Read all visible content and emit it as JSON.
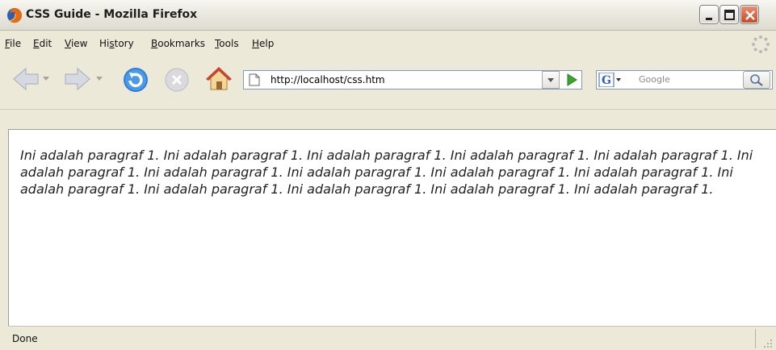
{
  "window": {
    "title": "CSS Guide - Mozilla Firefox"
  },
  "menu": {
    "items": [
      {
        "key": "F",
        "rest": "ile"
      },
      {
        "key": "E",
        "rest": "dit"
      },
      {
        "key": "V",
        "rest": "iew"
      },
      {
        "pre": "Hi",
        "key": "s",
        "rest": "tory"
      },
      {
        "key": "B",
        "rest": "ookmarks"
      },
      {
        "key": "T",
        "rest": "ools"
      },
      {
        "key": "H",
        "rest": "elp"
      }
    ]
  },
  "navigation": {
    "url": "http://localhost/css.htm",
    "search_placeholder": "Google",
    "search_engine_label": "G"
  },
  "page": {
    "paragraph": "Ini adalah paragraf 1. Ini adalah paragraf 1. Ini adalah paragraf 1. Ini adalah paragraf 1. Ini adalah paragraf 1. Ini adalah paragraf 1. Ini adalah paragraf 1. Ini adalah paragraf 1. Ini adalah paragraf 1. Ini adalah paragraf 1. Ini adalah paragraf 1. Ini adalah paragraf 1. Ini adalah paragraf 1. Ini adalah paragraf 1. Ini adalah paragraf 1."
  },
  "status": {
    "text": "Done"
  },
  "colors": {
    "chrome": "#ece9d8",
    "close_button": "#c84a26",
    "url_border": "#7f9db9",
    "go_green": "#3aa52c"
  }
}
